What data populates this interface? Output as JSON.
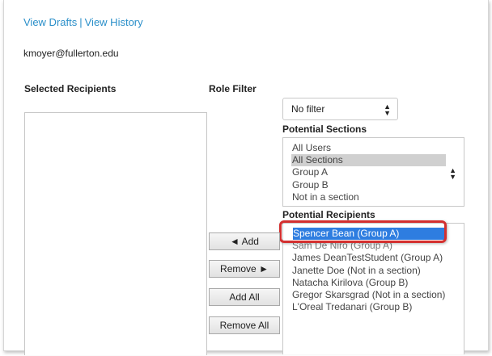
{
  "links": {
    "view_drafts": "View Drafts",
    "separator": "|",
    "view_history": "View History"
  },
  "user": {
    "email": "kmoyer@fullerton.edu"
  },
  "headings": {
    "selected_recipients": "Selected Recipients",
    "role_filter": "Role Filter",
    "potential_sections": "Potential Sections",
    "potential_recipients": "Potential Recipients"
  },
  "role_filter": {
    "selected": "No filter"
  },
  "sections": [
    "All Users",
    "All Sections",
    "Group A",
    "Group B",
    "Not in a section"
  ],
  "sections_selected_index": 1,
  "recipients": [
    "Spencer Bean (Group A)",
    "Sam De Niro (Group A)",
    "James DeanTestStudent (Group A)",
    "Janette Doe (Not in a section)",
    "Natacha Kirilova (Group B)",
    "Gregor Skarsgrad (Not in a section)",
    "L'Oreal Tredanari (Group B)"
  ],
  "recipients_selected_index": 0,
  "buttons": {
    "add": "◄ Add",
    "remove": "Remove ►",
    "add_all": "Add All",
    "remove_all": "Remove All"
  },
  "colors": {
    "link": "#2a8fc9",
    "selection": "#2e7de0",
    "callout": "#d32f2f"
  }
}
